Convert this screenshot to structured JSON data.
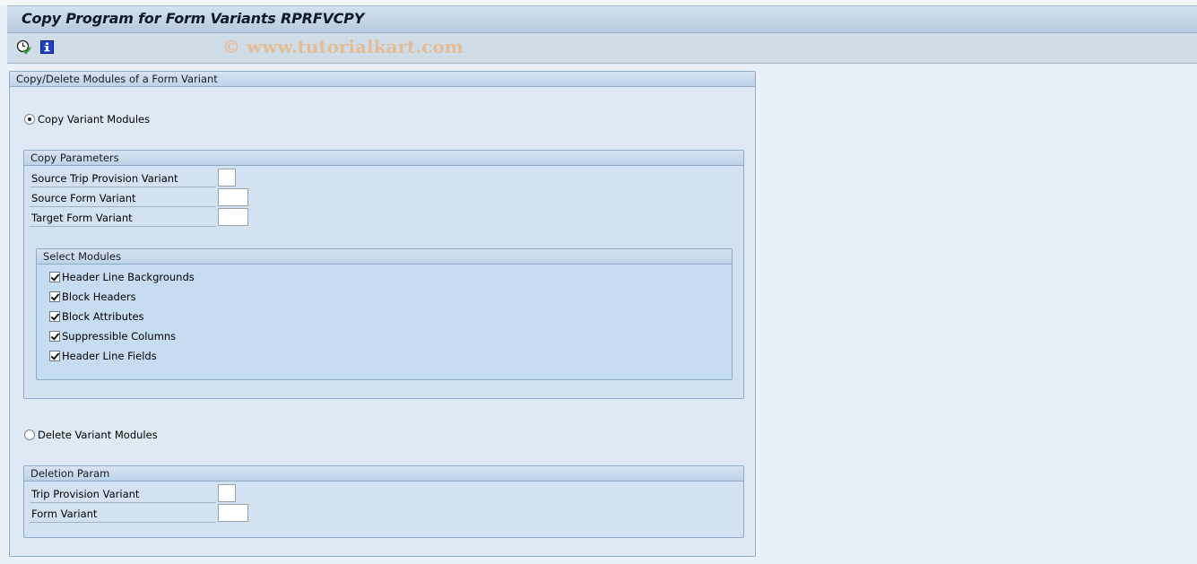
{
  "window": {
    "title": "Copy Program for Form Variants RPRFVCPY",
    "watermark": "© www.tutorialkart.com"
  },
  "toolbar": {
    "items": [
      {
        "icon": "execute-clock-icon",
        "label": "Execute"
      },
      {
        "icon": "info-icon",
        "label": "Program Documentation"
      }
    ]
  },
  "main_group": {
    "title": "Copy/Delete Modules of a Form Variant",
    "copy_option": {
      "label": "Copy Variant Modules",
      "selected": true
    },
    "delete_option": {
      "label": "Delete Variant Modules",
      "selected": false
    }
  },
  "copy_parameters": {
    "title": "Copy Parameters",
    "fields": [
      {
        "label": "Source Trip Provision Variant",
        "value": "",
        "size": "short"
      },
      {
        "label": "Source Form Variant",
        "value": "",
        "size": "long"
      },
      {
        "label": "Target Form Variant",
        "value": "",
        "size": "long"
      }
    ]
  },
  "select_modules": {
    "title": "Select Modules",
    "items": [
      {
        "label": "Header Line Backgrounds",
        "checked": true
      },
      {
        "label": "Block Headers",
        "checked": true
      },
      {
        "label": "Block Attributes",
        "checked": true
      },
      {
        "label": "Suppressible Columns",
        "checked": true
      },
      {
        "label": "Header Line Fields",
        "checked": true
      }
    ]
  },
  "deletion_param": {
    "title": "Deletion Param",
    "fields": [
      {
        "label": "Trip Provision Variant",
        "value": "",
        "size": "short"
      },
      {
        "label": "Form Variant",
        "value": "",
        "size": "long"
      }
    ]
  }
}
